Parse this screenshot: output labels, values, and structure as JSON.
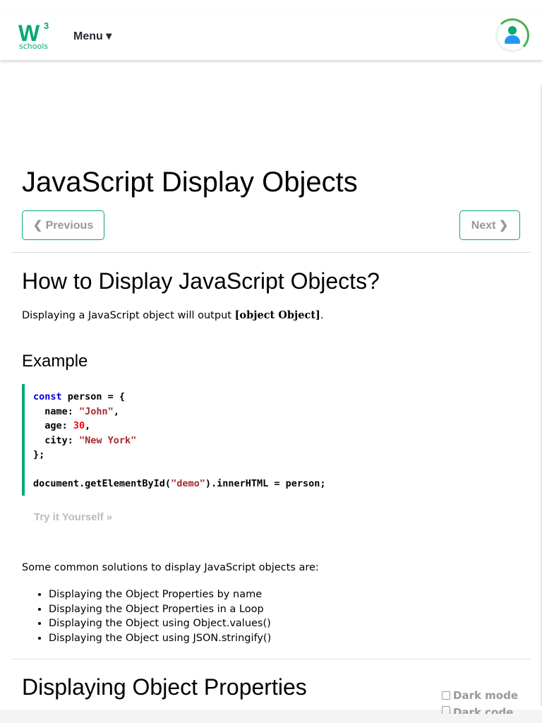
{
  "header": {
    "logo_text": "w3schools",
    "menu_label": "Menu ▾"
  },
  "page": {
    "title": "JavaScript Display Objects",
    "prev_label": "❮ Previous",
    "next_label": "Next ❯"
  },
  "section1": {
    "heading": "How to Display JavaScript Objects?",
    "intro_prefix": "Displaying a JavaScript object will output ",
    "intro_code": "[object Object]",
    "intro_suffix": ".",
    "example_heading": "Example",
    "code": {
      "l1_kw": "const",
      "l1": " person = {",
      "l2": "  name: ",
      "l2_str": "\"John\"",
      "l2_end": ",",
      "l3": "  age: ",
      "l3_num": "30",
      "l3_end": ",",
      "l4": "  city: ",
      "l4_str": "\"New York\"",
      "l5": "};",
      "l7a": "document.getElementById(",
      "l7_str": "\"demo\"",
      "l7b": ").innerHTML = person;"
    },
    "try_label": "Try it Yourself »",
    "solutions_intro": "Some common solutions to display JavaScript objects are:",
    "solutions": [
      "Displaying the Object Properties by name",
      "Displaying the Object Properties in a Loop",
      "Displaying the Object using Object.values()",
      "Displaying the Object using JSON.stringify()"
    ]
  },
  "section2": {
    "heading": "Displaying Object Properties"
  },
  "toggles": {
    "dark_mode": "Dark mode",
    "dark_code": "Dark code"
  }
}
